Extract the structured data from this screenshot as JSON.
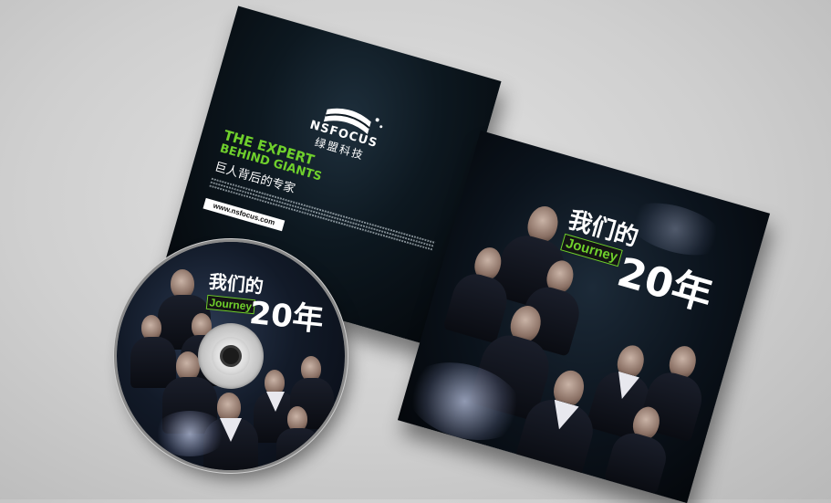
{
  "sleeve": {
    "brand": "NSFOCUS",
    "brand_cn": "绿盟科技",
    "slogan_en_1": "THE EXPERT",
    "slogan_en_2": "BEHIND GIANTS",
    "slogan_cn": "巨人背后的专家",
    "url": "www.nsfocus.com"
  },
  "disc": {
    "title_cn": "我们的",
    "title_en": "Journey",
    "title_num": "20年"
  },
  "cover": {
    "title_cn": "我们的",
    "title_en": "Journey",
    "title_num": "20年"
  },
  "colors": {
    "accent_green": "#6fcf2c",
    "background": "#cfcfcf",
    "sleeve_dark": "#0d1820"
  }
}
